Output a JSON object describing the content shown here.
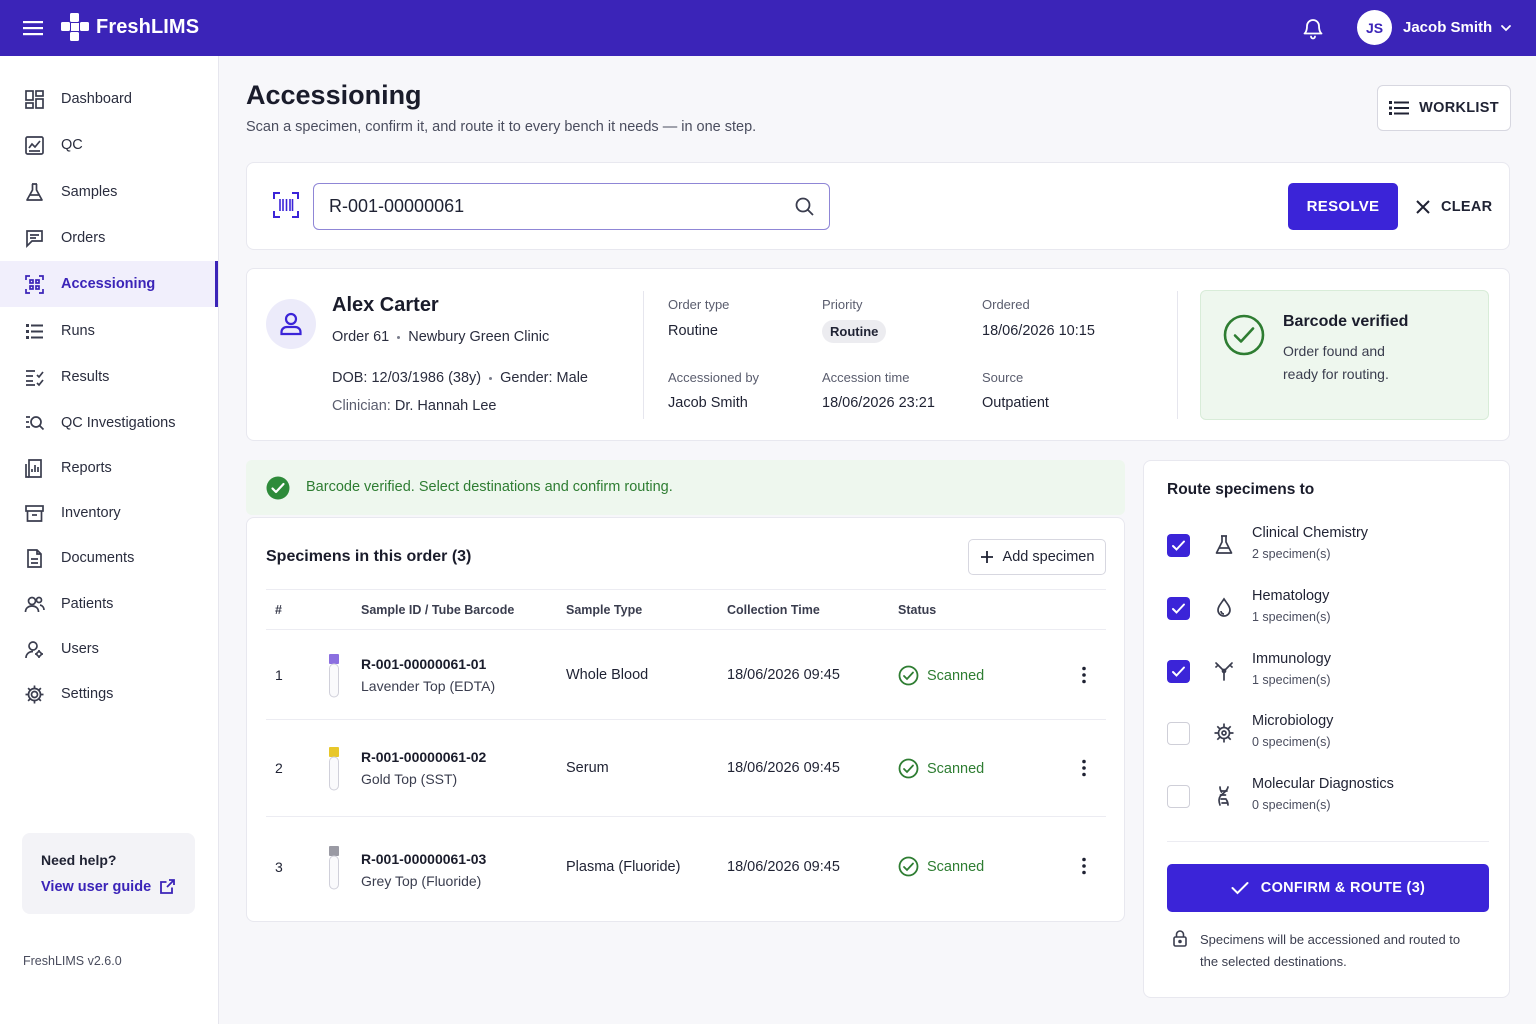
{
  "app": {
    "name": "FreshLIMS",
    "version": "FreshLIMS v2.6.0"
  },
  "topbar": {
    "user_initials": "JS",
    "user_name": "Jacob Smith"
  },
  "sidebar": {
    "items": [
      {
        "label": "Dashboard",
        "icon": "dashboard-icon"
      },
      {
        "label": "QC",
        "icon": "qc-icon"
      },
      {
        "label": "Samples",
        "icon": "flask-icon"
      },
      {
        "label": "Orders",
        "icon": "orders-icon"
      },
      {
        "label": "Accessioning",
        "icon": "barcode-scan-icon",
        "active": true
      },
      {
        "label": "Runs",
        "icon": "list-icon"
      },
      {
        "label": "Results",
        "icon": "results-icon"
      },
      {
        "label": "QC Investigations",
        "icon": "search-list-icon"
      },
      {
        "label": "Reports",
        "icon": "report-icon"
      },
      {
        "label": "Inventory",
        "icon": "box-icon"
      },
      {
        "label": "Documents",
        "icon": "document-icon"
      },
      {
        "label": "Patients",
        "icon": "patients-icon"
      },
      {
        "label": "Users",
        "icon": "users-icon"
      },
      {
        "label": "Settings",
        "icon": "gear-icon"
      }
    ],
    "help": {
      "title": "Need help?",
      "link": "View user guide"
    }
  },
  "header": {
    "title": "Accessioning",
    "subtitle": "Scan a specimen, confirm it, and route it to every bench it needs — in one step.",
    "worklist_label": "WORKLIST"
  },
  "scan": {
    "value": "R-001-00000061",
    "resolve_label": "RESOLVE",
    "clear_label": "CLEAR"
  },
  "patient": {
    "name": "Alex Carter",
    "order": "Order 61",
    "clinic": "Newbury Green Clinic",
    "dob": "DOB: 12/03/1986 (38y)",
    "gender": "Gender: Male",
    "clinician_label": "Clinician:",
    "clinician": "Dr. Hannah Lee",
    "meta": {
      "order_type_label": "Order type",
      "order_type": "Routine",
      "priority_label": "Priority",
      "priority": "Routine",
      "ordered_label": "Ordered",
      "ordered": "18/06/2026 10:15",
      "accessioned_by_label": "Accessioned by",
      "accessioned_by": "Jacob Smith",
      "accession_time_label": "Accession time",
      "accession_time": "18/06/2026 23:21",
      "source_label": "Source",
      "source": "Outpatient"
    },
    "verified": {
      "title": "Barcode verified",
      "subtitle": "Order found and ready for routing."
    }
  },
  "alert": {
    "text": "Barcode verified. Select destinations and confirm routing."
  },
  "specimens": {
    "title": "Specimens in this order (3)",
    "add_label": "Add specimen",
    "columns": [
      "#",
      "Sample ID / Tube Barcode",
      "Sample Type",
      "Collection Time",
      "Status"
    ],
    "rows": [
      {
        "num": "1",
        "id": "R-001-00000061-01",
        "top": "Lavender Top (EDTA)",
        "cap_color": "#8b6fe0",
        "type": "Whole Blood",
        "time": "18/06/2026 09:45",
        "status": "Scanned"
      },
      {
        "num": "2",
        "id": "R-001-00000061-02",
        "top": "Gold Top (SST)",
        "cap_color": "#e8c72a",
        "type": "Serum",
        "time": "18/06/2026 09:45",
        "status": "Scanned"
      },
      {
        "num": "3",
        "id": "R-001-00000061-03",
        "top": "Grey Top (Fluoride)",
        "cap_color": "#9a9aa4",
        "type": "Plasma (Fluoride)",
        "time": "18/06/2026 09:45",
        "status": "Scanned"
      }
    ]
  },
  "route": {
    "title": "Route specimens to",
    "items": [
      {
        "name": "Clinical Chemistry",
        "count": "2 specimen(s)",
        "checked": true,
        "icon": "flask-icon"
      },
      {
        "name": "Hematology",
        "count": "1 specimen(s)",
        "checked": true,
        "icon": "drop-icon"
      },
      {
        "name": "Immunology",
        "count": "1 specimen(s)",
        "checked": true,
        "icon": "antibody-icon"
      },
      {
        "name": "Microbiology",
        "count": "0 specimen(s)",
        "checked": false,
        "icon": "microbe-icon"
      },
      {
        "name": "Molecular Diagnostics",
        "count": "0 specimen(s)",
        "checked": false,
        "icon": "dna-icon"
      }
    ],
    "confirm_label": "CONFIRM & ROUTE (3)",
    "note": "Specimens will be accessioned and routed to the selected destinations."
  },
  "colors": {
    "brand": "#3b24b8",
    "primary_button": "#3b24d8",
    "success": "#2e7d32",
    "success_bg": "#eef7ee"
  }
}
